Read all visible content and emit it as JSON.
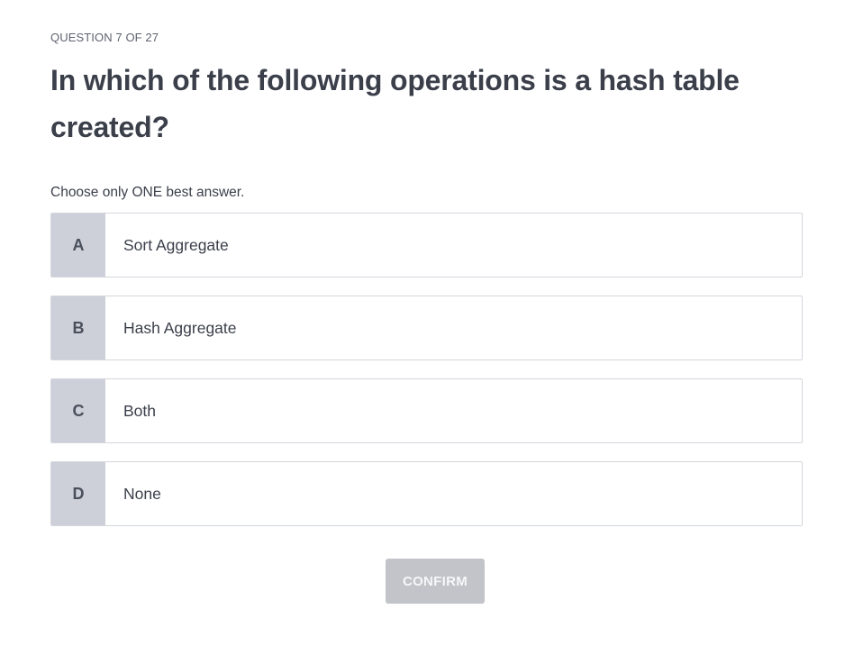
{
  "quiz": {
    "progress": "QUESTION 7 OF 27",
    "question": "In which of the following operations is a hash table created?",
    "instruction": "Choose only ONE best answer.",
    "options": [
      {
        "letter": "A",
        "text": "Sort Aggregate"
      },
      {
        "letter": "B",
        "text": "Hash Aggregate"
      },
      {
        "letter": "C",
        "text": "Both"
      },
      {
        "letter": "D",
        "text": "None"
      }
    ],
    "confirm_label": "CONFIRM"
  },
  "colors": {
    "letter_bg": "#cdd0d9",
    "option_border": "#d3d6dc",
    "confirm_disabled_bg": "#c2c4c9",
    "text": "#3b3f4a"
  }
}
